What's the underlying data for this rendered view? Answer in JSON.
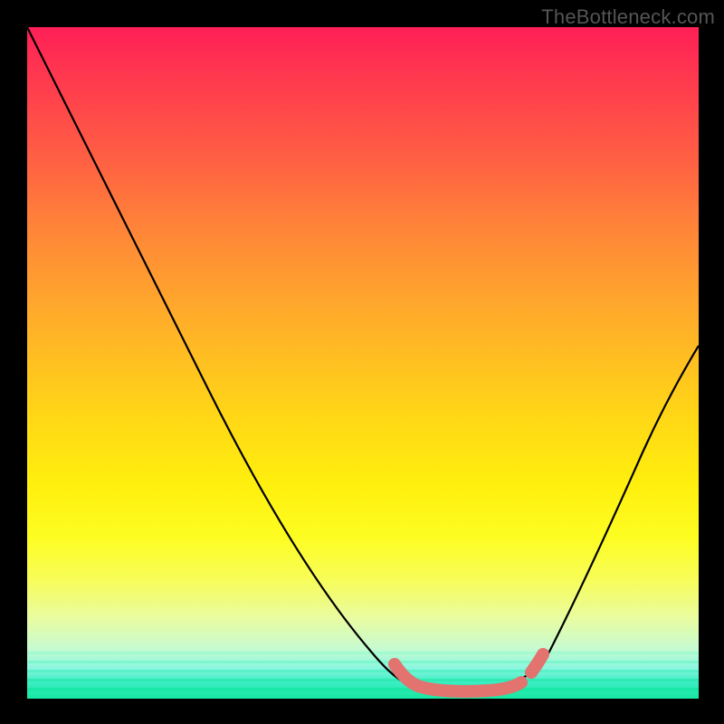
{
  "watermark": "TheBottleneck.com",
  "chart_data": {
    "type": "line",
    "title": "",
    "xlabel": "",
    "ylabel": "",
    "xlim": [
      0,
      1
    ],
    "ylim": [
      0,
      1
    ],
    "series": [
      {
        "name": "bottleneck-curve",
        "x": [
          0.0,
          0.06,
          0.12,
          0.18,
          0.24,
          0.3,
          0.36,
          0.42,
          0.48,
          0.52,
          0.57,
          0.62,
          0.67,
          0.72,
          0.76,
          0.82,
          0.88,
          0.94,
          1.0
        ],
        "y": [
          1.0,
          0.9,
          0.8,
          0.7,
          0.6,
          0.5,
          0.4,
          0.3,
          0.18,
          0.08,
          0.02,
          0.01,
          0.01,
          0.02,
          0.05,
          0.13,
          0.25,
          0.38,
          0.52
        ]
      },
      {
        "name": "optimal-range-marker",
        "x": [
          0.55,
          0.57,
          0.59,
          0.62,
          0.65,
          0.68,
          0.71,
          0.73,
          0.75,
          0.76,
          0.77
        ],
        "y": [
          0.045,
          0.025,
          0.015,
          0.01,
          0.01,
          0.01,
          0.012,
          0.02,
          0.035,
          0.05,
          0.065
        ]
      }
    ],
    "colors": {
      "gradient_top": "#ff1f57",
      "gradient_mid": "#ffd716",
      "gradient_bottom": "#16e7a1",
      "curve": "#000000",
      "marker": "#e2736e",
      "frame": "#000000"
    }
  }
}
